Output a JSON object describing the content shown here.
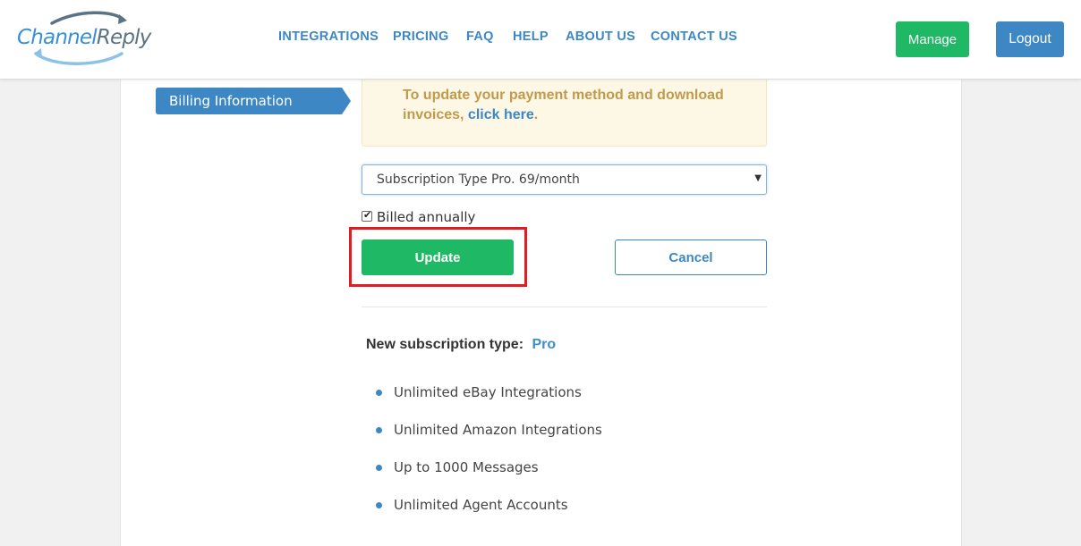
{
  "header": {
    "logo": {
      "part1": "Channel",
      "part2": "Reply"
    },
    "nav": [
      {
        "label": "INTEGRATIONS",
        "id": "integrations"
      },
      {
        "label": "PRICING",
        "id": "pricing"
      },
      {
        "label": "FAQ",
        "id": "faq"
      },
      {
        "label": "HELP",
        "id": "help"
      },
      {
        "label": "ABOUT US",
        "id": "about-us"
      },
      {
        "label": "CONTACT US",
        "id": "contact-us"
      }
    ],
    "manage_label": "Manage",
    "logout_label": "Logout"
  },
  "sidebar": {
    "active_tab": "Billing Information"
  },
  "notice": {
    "text": "To update your payment method and download invoices, ",
    "link": "click here",
    "suffix": "."
  },
  "form": {
    "subscription_select": {
      "value": "Subscription Type Pro. 69/month"
    },
    "billed_annually": {
      "label": "Billed annually",
      "checked": true
    },
    "update_label": "Update",
    "cancel_label": "Cancel"
  },
  "summary": {
    "label": "New subscription type:",
    "value": "Pro",
    "features": [
      "Unlimited eBay Integrations",
      "Unlimited Amazon Integrations",
      "Up to 1000 Messages",
      "Unlimited Agent Accounts"
    ]
  },
  "colors": {
    "brand_blue": "#3d87c4",
    "brand_green": "#1fb865",
    "highlight_red": "#e01c24",
    "notice_text": "#c29a4c"
  }
}
